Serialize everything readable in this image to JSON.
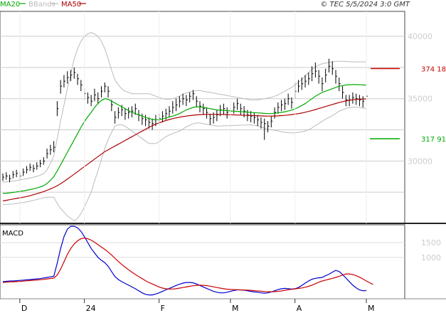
{
  "header": {
    "legend": [
      {
        "label": "MA20",
        "color": "#00aa00"
      },
      {
        "label": "BBands",
        "color": "#bbbbbb"
      },
      {
        "label": "MA50",
        "color": "#aa0000"
      }
    ],
    "copyright": "© TEC 5/5/2024 3:0 GMT"
  },
  "chart_data": [
    {
      "type": "ohlc",
      "title": "",
      "ylim": [
        25000,
        42000
      ],
      "y_ticks": [
        {
          "value": 40000,
          "label": "40000"
        },
        {
          "value": 35000,
          "label": "35000"
        },
        {
          "value": 30000,
          "label": "30000"
        }
      ],
      "x_ticks": [
        {
          "label": "D",
          "index": 5
        },
        {
          "label": "24",
          "index": 24
        },
        {
          "label": "F",
          "index": 46
        },
        {
          "label": "M",
          "index": 67
        },
        {
          "label": "M",
          "index": 107
        },
        {
          "label": "A",
          "index": 86
        }
      ],
      "series": [
        {
          "name": "MA20",
          "color": "#00aa00"
        },
        {
          "name": "BBands",
          "color": "#bbbbbb"
        },
        {
          "name": "MA50",
          "color": "#aa0000"
        }
      ],
      "close": [
        28700,
        28800,
        28600,
        28900,
        29000,
        28800,
        29100,
        29300,
        29500,
        29400,
        29600,
        29800,
        30000,
        30600,
        30900,
        31100,
        34200,
        36000,
        36400,
        36700,
        36900,
        37100,
        36600,
        36100,
        35400,
        35100,
        34800,
        35300,
        35000,
        35600,
        36000,
        35600,
        34500,
        33500,
        33900,
        34100,
        33800,
        33900,
        34000,
        34200,
        33700,
        33400,
        33300,
        33100,
        33000,
        33300,
        33400,
        33600,
        33800,
        34000,
        34300,
        34500,
        34800,
        35000,
        34900,
        35200,
        35400,
        34800,
        34400,
        34200,
        33900,
        33400,
        33500,
        33700,
        34100,
        34200,
        33900,
        34000,
        34300,
        34600,
        34200,
        34000,
        33700,
        33600,
        33500,
        33300,
        33100,
        33000,
        32800,
        33200,
        33900,
        34300,
        34500,
        34600,
        35000,
        34700,
        35600,
        36000,
        36200,
        36400,
        36600,
        37000,
        37200,
        36800,
        36200,
        36900,
        37600,
        37400,
        36800,
        36200,
        35500,
        34900,
        34900,
        35100,
        35000,
        34900,
        34800,
        35200
      ],
      "high": [
        29000,
        29100,
        28900,
        29200,
        29300,
        29100,
        29400,
        29600,
        29800,
        29700,
        29900,
        30100,
        30300,
        31000,
        31300,
        31600,
        34800,
        36500,
        36900,
        37200,
        37300,
        37500,
        37000,
        36500,
        35800,
        35500,
        35300,
        35800,
        35500,
        36000,
        36300,
        36000,
        34900,
        34000,
        34300,
        34500,
        34200,
        34300,
        34400,
        34600,
        34100,
        33800,
        33700,
        33500,
        33400,
        33700,
        33800,
        34000,
        34200,
        34400,
        34800,
        35000,
        35200,
        35400,
        35300,
        35500,
        35700,
        35200,
        34800,
        34600,
        34300,
        33800,
        33900,
        34100,
        34500,
        34600,
        34300,
        34400,
        34700,
        35000,
        34600,
        34400,
        34100,
        34000,
        33900,
        33700,
        33500,
        33400,
        33200,
        33600,
        34300,
        34700,
        34900,
        35000,
        35400,
        35100,
        36300,
        36500,
        36700,
        36900,
        37100,
        37600,
        37900,
        37300,
        36700,
        37400,
        38200,
        38000,
        37300,
        36700,
        36000,
        35300,
        35300,
        35500,
        35400,
        35300,
        35200,
        35600
      ],
      "low": [
        28400,
        28500,
        28300,
        28600,
        28700,
        28500,
        28800,
        29000,
        29200,
        29100,
        29300,
        29500,
        29700,
        30200,
        30500,
        30700,
        33600,
        35400,
        35900,
        36200,
        36400,
        36600,
        36100,
        35600,
        34900,
        34600,
        34400,
        34800,
        34600,
        35100,
        35500,
        35100,
        34000,
        33000,
        33400,
        33600,
        33300,
        33400,
        33500,
        33700,
        33200,
        32900,
        32800,
        32600,
        32500,
        32800,
        32900,
        33100,
        33300,
        33500,
        33800,
        34000,
        34300,
        34500,
        34400,
        34700,
        34900,
        34300,
        33900,
        33700,
        33400,
        32900,
        33000,
        33200,
        33600,
        33700,
        33400,
        33500,
        33800,
        34100,
        33700,
        33500,
        33200,
        33100,
        33000,
        32800,
        32600,
        31700,
        32300,
        32700,
        33400,
        33800,
        34000,
        34100,
        34500,
        34200,
        35000,
        35500,
        35700,
        35900,
        36100,
        36400,
        36700,
        36200,
        35600,
        36300,
        37100,
        36900,
        36200,
        35600,
        35000,
        34400,
        34400,
        34600,
        34500,
        34400,
        34300,
        34700
      ],
      "ma20": [
        27400,
        27420,
        27450,
        27480,
        27520,
        27560,
        27600,
        27650,
        27710,
        27770,
        27840,
        27920,
        28020,
        28200,
        28450,
        28750,
        29200,
        29700,
        30200,
        30700,
        31200,
        31700,
        32200,
        32700,
        33150,
        33550,
        33900,
        34300,
        34600,
        34850,
        35000,
        34950,
        34800,
        34650,
        34500,
        34350,
        34200,
        34050,
        33900,
        33800,
        33700,
        33600,
        33500,
        33400,
        33350,
        33300,
        33320,
        33380,
        33450,
        33520,
        33600,
        33700,
        33800,
        33950,
        34100,
        34200,
        34300,
        34350,
        34350,
        34300,
        34250,
        34200,
        34150,
        34100,
        34080,
        34060,
        34040,
        34020,
        34000,
        33980,
        33960,
        33940,
        33920,
        33900,
        33880,
        33860,
        33840,
        33820,
        33800,
        33810,
        33830,
        33860,
        33900,
        33950,
        34010,
        34080,
        34180,
        34300,
        34450,
        34600,
        34800,
        35000,
        35200,
        35350,
        35500,
        35600,
        35700,
        35800,
        35900,
        36000,
        36050,
        36100,
        36120,
        36130,
        36130,
        36120,
        36100,
        36080
      ],
      "bb_upper": [
        28300,
        28330,
        28360,
        28400,
        28440,
        28480,
        28530,
        28580,
        28640,
        28700,
        28770,
        28860,
        28980,
        29300,
        29800,
        30400,
        31800,
        33200,
        34500,
        35800,
        37000,
        38200,
        39000,
        39600,
        40000,
        40200,
        40300,
        40200,
        40000,
        39600,
        39000,
        38200,
        37300,
        36500,
        36100,
        35800,
        35600,
        35500,
        35400,
        35400,
        35400,
        35400,
        35400,
        35400,
        35300,
        35200,
        35100,
        35000,
        34950,
        34950,
        35000,
        35100,
        35200,
        35350,
        35450,
        35550,
        35600,
        35650,
        35650,
        35600,
        35550,
        35500,
        35450,
        35400,
        35350,
        35300,
        35250,
        35200,
        35150,
        35100,
        35050,
        35000,
        34950,
        34900,
        34900,
        34900,
        34950,
        35000,
        35050,
        35100,
        35200,
        35300,
        35450,
        35600,
        35750,
        35900,
        36100,
        36300,
        36550,
        36800,
        37100,
        37350,
        37550,
        37700,
        37800,
        37850,
        37900,
        37950,
        38000,
        38000,
        38000,
        37980,
        37960,
        37950,
        37950,
        37950,
        37950,
        37950
      ],
      "bb_lower": [
        26500,
        26510,
        26540,
        26560,
        26600,
        26640,
        26670,
        26720,
        26780,
        26840,
        26910,
        26980,
        27060,
        27100,
        27100,
        27100,
        26600,
        26200,
        25900,
        25600,
        25400,
        25200,
        25400,
        25800,
        26300,
        26900,
        27500,
        28400,
        29200,
        30100,
        31000,
        31700,
        32300,
        32800,
        32900,
        32900,
        32800,
        32600,
        32400,
        32200,
        32000,
        31800,
        31600,
        31400,
        31400,
        31400,
        31540,
        31760,
        31950,
        32090,
        32200,
        32300,
        32400,
        32550,
        32750,
        32850,
        33000,
        33050,
        33050,
        33000,
        32950,
        32900,
        32850,
        32800,
        32810,
        32820,
        32830,
        32840,
        32850,
        32860,
        32870,
        32880,
        32890,
        32900,
        32860,
        32820,
        32730,
        32640,
        32550,
        32520,
        32460,
        32420,
        32350,
        32300,
        32270,
        32260,
        32260,
        32300,
        32350,
        32400,
        32500,
        32650,
        32850,
        33000,
        33200,
        33350,
        33500,
        33650,
        33800,
        34000,
        34100,
        34220,
        34280,
        34310,
        34310,
        34290,
        34250,
        34210
      ],
      "ma50": [
        26800,
        26850,
        26900,
        26950,
        27000,
        27050,
        27100,
        27150,
        27220,
        27300,
        27380,
        27460,
        27550,
        27650,
        27760,
        27880,
        28020,
        28180,
        28360,
        28550,
        28750,
        28950,
        29150,
        29350,
        29550,
        29750,
        29950,
        30150,
        30350,
        30550,
        30750,
        30900,
        31050,
        31200,
        31350,
        31500,
        31650,
        31800,
        31950,
        32100,
        32250,
        32400,
        32550,
        32700,
        32830,
        32950,
        33060,
        33160,
        33250,
        33330,
        33400,
        33460,
        33510,
        33560,
        33600,
        33640,
        33670,
        33700,
        33720,
        33730,
        33740,
        33740,
        33740,
        33740,
        33740,
        33730,
        33720,
        33710,
        33700,
        33690,
        33680,
        33670,
        33660,
        33650,
        33640,
        33630,
        33620,
        33610,
        33600,
        33600,
        33610,
        33620,
        33640,
        33660,
        33690,
        33720,
        33760,
        33800,
        33850,
        33910,
        33980,
        34050,
        34130,
        34210,
        34290,
        34370,
        34450,
        34530,
        34610,
        34690,
        34760,
        34820,
        34870,
        34910,
        34940,
        34960,
        34970,
        34980
      ],
      "levels": [
        {
          "value": 37418,
          "label": "374 18",
          "color": "#cc0000"
        },
        {
          "value": 31791,
          "label": "317 91",
          "color": "#00aa00"
        }
      ]
    },
    {
      "type": "line",
      "title": "MACD",
      "ylim": [
        -400,
        2100
      ],
      "y_ticks": [
        {
          "value": 1500,
          "label": "1500"
        },
        {
          "value": 1000,
          "label": "1000"
        }
      ],
      "series": [
        {
          "color": "#0000cc",
          "values": [
            180,
            190,
            200,
            200,
            210,
            220,
            230,
            240,
            250,
            260,
            270,
            280,
            300,
            320,
            340,
            360,
            800,
            1300,
            1700,
            1950,
            2050,
            2050,
            2000,
            1880,
            1700,
            1500,
            1300,
            1150,
            1000,
            900,
            820,
            700,
            520,
            350,
            250,
            180,
            120,
            60,
            0,
            -60,
            -130,
            -200,
            -250,
            -270,
            -270,
            -240,
            -200,
            -150,
            -100,
            -50,
            0,
            50,
            90,
            130,
            150,
            150,
            140,
            100,
            50,
            0,
            -50,
            -100,
            -150,
            -180,
            -200,
            -200,
            -180,
            -150,
            -120,
            -100,
            -100,
            -110,
            -130,
            -150,
            -170,
            -180,
            -200,
            -210,
            -200,
            -170,
            -130,
            -90,
            -60,
            -50,
            -60,
            -70,
            -60,
            -20,
            50,
            130,
            200,
            260,
            290,
            310,
            320,
            380,
            430,
            500,
            560,
            520,
            420,
            300,
            180,
            60,
            -30,
            -100,
            -130,
            -120
          ]
        },
        {
          "color": "#cc0000",
          "values": [
            150,
            160,
            170,
            175,
            180,
            185,
            195,
            205,
            215,
            225,
            235,
            245,
            255,
            270,
            285,
            300,
            400,
            600,
            850,
            1100,
            1300,
            1450,
            1560,
            1630,
            1650,
            1630,
            1580,
            1510,
            1430,
            1350,
            1270,
            1180,
            1080,
            970,
            860,
            760,
            670,
            580,
            500,
            420,
            350,
            280,
            210,
            150,
            100,
            50,
            0,
            -40,
            -60,
            -70,
            -70,
            -60,
            -40,
            -20,
            0,
            20,
            40,
            55,
            60,
            55,
            45,
            25,
            5,
            -20,
            -40,
            -60,
            -75,
            -85,
            -90,
            -95,
            -100,
            -105,
            -110,
            -115,
            -125,
            -135,
            -145,
            -155,
            -160,
            -165,
            -160,
            -150,
            -135,
            -115,
            -95,
            -80,
            -65,
            -50,
            -35,
            -10,
            20,
            60,
            110,
            160,
            200,
            230,
            260,
            290,
            320,
            360,
            400,
            440,
            440,
            420,
            380,
            330,
            270,
            200,
            140,
            80
          ]
        }
      ]
    }
  ],
  "macd_label": "MACD"
}
